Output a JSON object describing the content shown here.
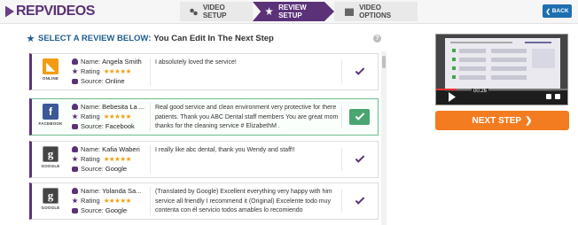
{
  "brand": {
    "logo": "REPVIDEOS"
  },
  "steps": [
    {
      "label": "VIDEO SETUP",
      "icon": "settings-icon",
      "active": false
    },
    {
      "label": "REVIEW SETUP",
      "icon": "star-icon",
      "active": true
    },
    {
      "label": "VIDEO OPTIONS",
      "icon": "film-icon",
      "active": false
    }
  ],
  "back_label": "BACK",
  "heading": {
    "lead": "SELECT A REVIEW BELOW:",
    "rest": "You Can Edit In The Next Step"
  },
  "field_labels": {
    "name": "Name:",
    "rating": "Rating",
    "source": "Source:"
  },
  "reviews": [
    {
      "source_caption": "ONLINE",
      "source_icon": "rss-icon",
      "name": "Angela Smith",
      "rating": 5,
      "stars": "★★★★★",
      "source": "Online",
      "text": "I absolutely loved the service!",
      "selected": false
    },
    {
      "source_caption": "FACEBOOK",
      "source_icon": "facebook-icon",
      "name": "Bebesita La ...",
      "rating": 5,
      "stars": "★★★★★",
      "source": "Facebook",
      "text": "Real good service and clean environment very protective for there patients. Thank you ABC Dental staff members You are great mom thanks for the cleaning service # ElizabethM .",
      "selected": true
    },
    {
      "source_caption": "GOOGLE",
      "source_icon": "google-icon",
      "name": "Kafia Waberi",
      "rating": 5,
      "stars": "★★★★★",
      "source": "Google",
      "text": "I really like abc dental, thank you Wendy and staff!!",
      "selected": false
    },
    {
      "source_caption": "GOOGLE",
      "source_icon": "google-icon",
      "name": "Yolanda Sa...",
      "rating": 5,
      "stars": "★★★★★",
      "source": "Google",
      "text": "(Translated by Google) Excellent everything very happy with him service all friendly I recommend it (Original) Excelente todo muy contenta con él servicio todos amables lo recomiendo",
      "selected": false
    }
  ],
  "video": {
    "time": "00:26",
    "progress": 0.15
  },
  "next_step_label": "NEXT STEP",
  "colors": {
    "brand_purple": "#5b3278",
    "accent_orange": "#f47c20",
    "selected_green": "#4aa56f",
    "back_blue": "#1e6fb0"
  }
}
